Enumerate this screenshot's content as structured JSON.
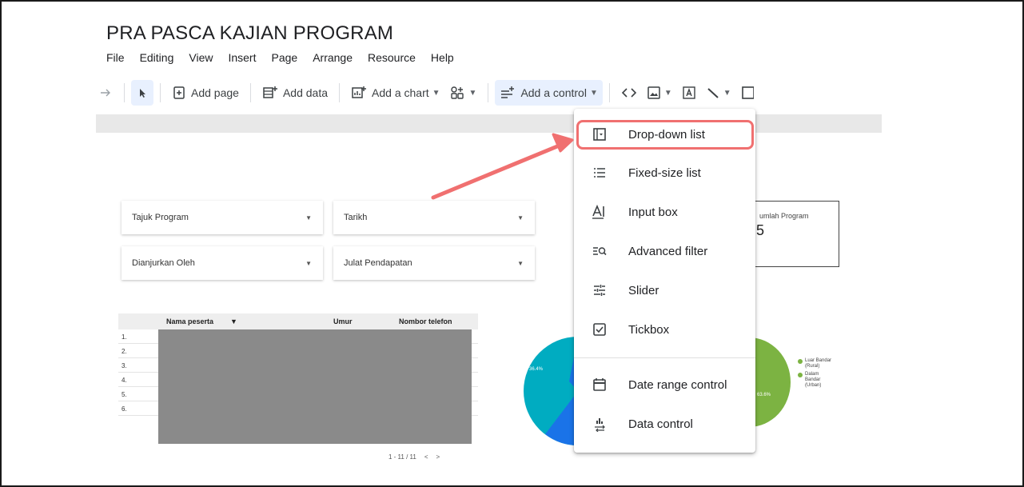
{
  "app": {
    "doc_title": "PRA PASCA KAJIAN PROGRAM"
  },
  "menubar": [
    "File",
    "Editing",
    "View",
    "Insert",
    "Page",
    "Arrange",
    "Resource",
    "Help"
  ],
  "toolbar": {
    "add_page": "Add page",
    "add_data": "Add data",
    "add_chart": "Add a chart",
    "add_control": "Add a control"
  },
  "filters": {
    "tajuk": "Tajuk Program",
    "tarikh": "Tarikh",
    "dianjurkan": "Dianjurkan Oleh",
    "julat": "Julat Pendapatan"
  },
  "scorecard": {
    "label": "umlah Program",
    "value": "5"
  },
  "table": {
    "headers": [
      "Nama peserta",
      "Umur",
      "Nombor telefon"
    ],
    "rows": [
      "1.",
      "2.",
      "3.",
      "4.",
      "5.",
      "6."
    ],
    "pager": "1 - 11 / 11"
  },
  "pie": {
    "left_label": "36.4%",
    "right_label": "63.6%",
    "legend": [
      {
        "line1": "Luar Bandar",
        "line2": "(Rural)"
      },
      {
        "line1": "Dalam",
        "line2": "Bandar",
        "line3": "(Urban)"
      }
    ],
    "colors": {
      "rural": "#00acc1",
      "urban": "#7cb342",
      "other": "#1a73e8"
    }
  },
  "control_menu": {
    "items": [
      {
        "label": "Drop-down list",
        "icon": "dropdown-list-icon"
      },
      {
        "label": "Fixed-size list",
        "icon": "fixed-list-icon"
      },
      {
        "label": "Input box",
        "icon": "input-box-icon"
      },
      {
        "label": "Advanced filter",
        "icon": "advanced-filter-icon"
      },
      {
        "label": "Slider",
        "icon": "slider-icon"
      },
      {
        "label": "Tickbox",
        "icon": "tickbox-icon"
      },
      {
        "label": "Date range control",
        "icon": "calendar-icon"
      },
      {
        "label": "Data control",
        "icon": "data-control-icon"
      }
    ]
  },
  "colors": {
    "highlight": "#f07070",
    "toolbar_active": "#e8f0fe"
  }
}
